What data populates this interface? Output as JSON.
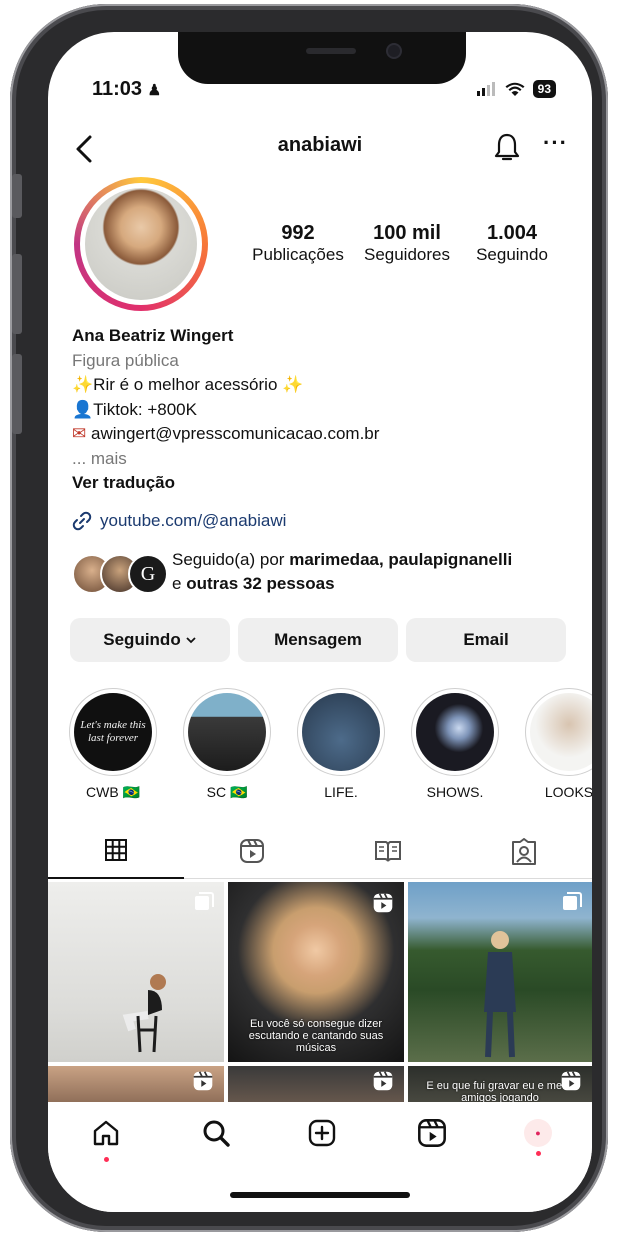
{
  "status": {
    "time": "11:03",
    "battery": "93"
  },
  "header": {
    "username": "anabiawi"
  },
  "stats": [
    {
      "value": "992",
      "label": "Publicações"
    },
    {
      "value": "100 mil",
      "label": "Seguidores"
    },
    {
      "value": "1.004",
      "label": "Seguindo"
    }
  ],
  "bio": {
    "name": "Ana Beatriz Wingert",
    "category": "Figura pública",
    "line1": "Rir é o melhor acessório",
    "line2": "Tiktok: +800K",
    "line3": "awingert@vpresscomunicacao.com.br",
    "more": "... mais",
    "translate": "Ver tradução"
  },
  "link": "youtube.com/@anabiawi",
  "followed_by": {
    "prefix": "Seguido(a) por",
    "names": "marimedaa, paulapignanelli",
    "connector": "e",
    "others": "outras 32 pessoas"
  },
  "buttons": {
    "following": "Seguindo",
    "message": "Mensagem",
    "email": "Email"
  },
  "highlights": [
    {
      "label": "CWB 🇧🇷",
      "text": "Let's make this last forever"
    },
    {
      "label": "SC 🇧🇷",
      "text": ""
    },
    {
      "label": "LIFE.",
      "text": ""
    },
    {
      "label": "SHOWS.",
      "text": ""
    },
    {
      "label": "LOOKS",
      "text": ""
    }
  ],
  "grid_captions": {
    "post2": "Eu você só consegue dizer escutando e cantando suas músicas",
    "post3": "E eu que fui gravar eu e meus amigos jogando"
  },
  "colors": {
    "link": "#1b3a6f",
    "notify_dot": "#ff2d55"
  }
}
